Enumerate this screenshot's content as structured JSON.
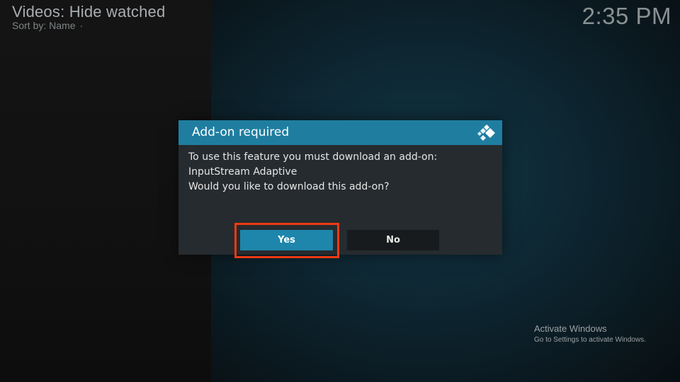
{
  "header": {
    "title": "Videos: Hide watched",
    "sort_label": "Sort by: Name",
    "sort_dot": "·"
  },
  "clock": "2:35 PM",
  "dialog": {
    "title": "Add-on required",
    "logo_icon": "kodi-logo-icon",
    "message_lines": [
      "To use this feature you must download an add-on:",
      "InputStream Adaptive",
      "Would you like to download this add-on?"
    ],
    "yes_label": "Yes",
    "no_label": "No",
    "focused_button": "Yes"
  },
  "watermark": {
    "title": "Activate Windows",
    "subtitle": "Go to Settings to activate Windows."
  },
  "colors": {
    "dialog_header": "#1f7ea0",
    "yes_button": "#1e86ab",
    "highlight": "#f03a12"
  }
}
